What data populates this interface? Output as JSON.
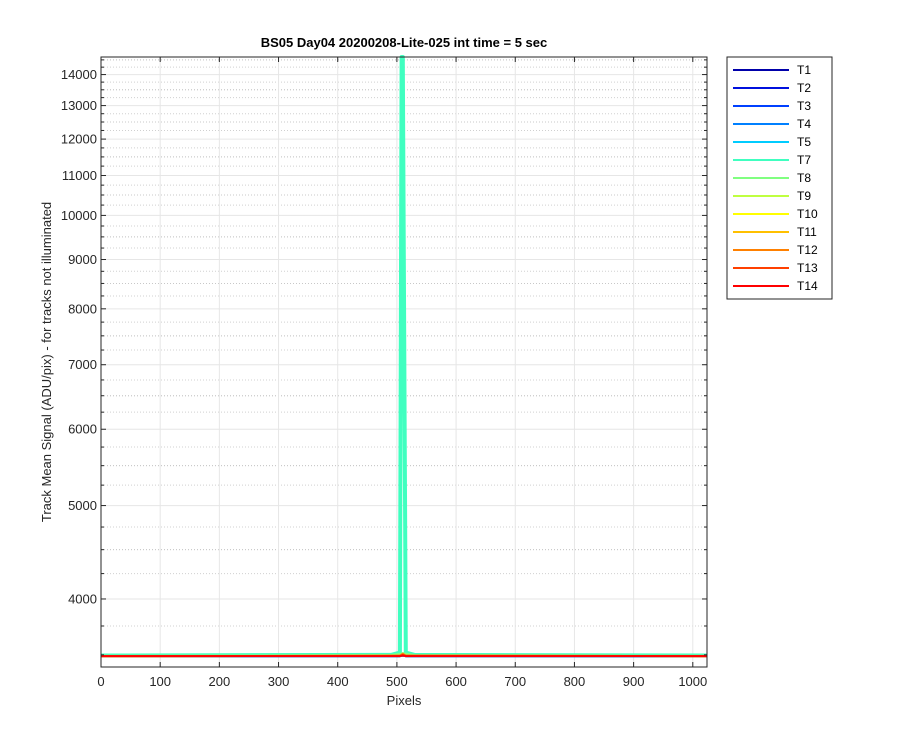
{
  "chart_data": {
    "type": "line",
    "title": "BS05 Day04 20200208-Lite-025 int time = 5 sec",
    "xlabel": "Pixels",
    "ylabel": "Track Mean Signal (ADU/pix) - for tracks not illuminated",
    "xlim": [
      0,
      1024
    ],
    "ylim": [
      3400,
      14600
    ],
    "yscale": "log",
    "x_ticks": [
      0,
      100,
      200,
      300,
      400,
      500,
      600,
      700,
      800,
      900,
      1000
    ],
    "y_ticks": [
      4000,
      5000,
      6000,
      7000,
      8000,
      9000,
      10000,
      11000,
      12000,
      13000,
      14000
    ],
    "grid": true,
    "minor_grid": true,
    "legend_position": "outside-right",
    "series": [
      {
        "name": "T1",
        "color": "#0000aa",
        "x": [
          0,
          505,
          510,
          515,
          1024
        ],
        "y": [
          3490,
          3490,
          3495,
          3490,
          3490
        ]
      },
      {
        "name": "T2",
        "color": "#0010dd",
        "x": [
          0,
          505,
          510,
          515,
          1024
        ],
        "y": [
          3490,
          3490,
          3495,
          3490,
          3490
        ]
      },
      {
        "name": "T3",
        "color": "#0040ff",
        "x": [
          0,
          505,
          510,
          515,
          1024
        ],
        "y": [
          3490,
          3490,
          3495,
          3490,
          3490
        ]
      },
      {
        "name": "T4",
        "color": "#0080ff",
        "x": [
          0,
          505,
          510,
          515,
          1024
        ],
        "y": [
          3490,
          3490,
          3495,
          3490,
          3490
        ]
      },
      {
        "name": "T5",
        "color": "#00ccff",
        "x": [
          0,
          505,
          510,
          515,
          1024
        ],
        "y": [
          3490,
          3490,
          3495,
          3490,
          3490
        ]
      },
      {
        "name": "T7",
        "color": "#40ffc0",
        "x": [
          0,
          490,
          505,
          508,
          510,
          515,
          530,
          1024
        ],
        "y": [
          3495,
          3500,
          3520,
          14600,
          14600,
          3520,
          3500,
          3495
        ]
      },
      {
        "name": "T8",
        "color": "#80ff80",
        "x": [
          0,
          490,
          505,
          510,
          515,
          530,
          1024
        ],
        "y": [
          3492,
          3498,
          3510,
          3515,
          3510,
          3498,
          3492
        ]
      },
      {
        "name": "T9",
        "color": "#bfff40",
        "x": [
          0,
          505,
          510,
          515,
          1024
        ],
        "y": [
          3490,
          3492,
          3500,
          3492,
          3490
        ]
      },
      {
        "name": "T10",
        "color": "#ffff00",
        "x": [
          0,
          505,
          510,
          515,
          1024
        ],
        "y": [
          3490,
          3492,
          3505,
          3492,
          3490
        ]
      },
      {
        "name": "T11",
        "color": "#ffc000",
        "x": [
          0,
          505,
          510,
          515,
          1024
        ],
        "y": [
          3490,
          3492,
          3505,
          3492,
          3490
        ]
      },
      {
        "name": "T12",
        "color": "#ff8000",
        "x": [
          0,
          505,
          510,
          515,
          1024
        ],
        "y": [
          3490,
          3492,
          3510,
          3492,
          3490
        ]
      },
      {
        "name": "T13",
        "color": "#ff4000",
        "x": [
          0,
          505,
          510,
          515,
          1024
        ],
        "y": [
          3490,
          3492,
          3500,
          3492,
          3490
        ]
      },
      {
        "name": "T14",
        "color": "#ff0000",
        "x": [
          0,
          505,
          510,
          515,
          1024
        ],
        "y": [
          3490,
          3490,
          3495,
          3490,
          3490
        ]
      }
    ]
  }
}
